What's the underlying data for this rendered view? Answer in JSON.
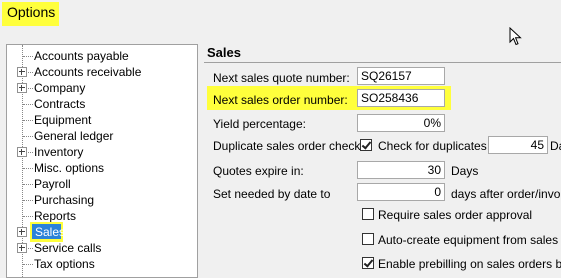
{
  "window": {
    "title": "Options"
  },
  "tree": {
    "items": [
      {
        "label": "Accounts payable",
        "expandable": false
      },
      {
        "label": "Accounts receivable",
        "expandable": true
      },
      {
        "label": "Company",
        "expandable": true
      },
      {
        "label": "Contracts",
        "expandable": false
      },
      {
        "label": "Equipment",
        "expandable": false
      },
      {
        "label": "General ledger",
        "expandable": false
      },
      {
        "label": "Inventory",
        "expandable": true
      },
      {
        "label": "Misc. options",
        "expandable": false
      },
      {
        "label": "Payroll",
        "expandable": false
      },
      {
        "label": "Purchasing",
        "expandable": false
      },
      {
        "label": "Reports",
        "expandable": false
      },
      {
        "label": "Sales",
        "expandable": true,
        "selected": true
      },
      {
        "label": "Service calls",
        "expandable": true
      },
      {
        "label": "Tax options",
        "expandable": false
      }
    ]
  },
  "sales": {
    "header": "Sales",
    "quote_label": "Next sales quote number:",
    "quote_value": "SQ26157",
    "order_label": "Next sales order number:",
    "order_value": "SO258436",
    "yield_label": "Yield percentage:",
    "yield_value": "0%",
    "dup_label": "Duplicate sales order check:",
    "dup_check_label": "Check for duplicates",
    "dup_check_checked": true,
    "dup_days_value": "45",
    "dup_days_suffix": "Da",
    "quotes_label": "Quotes expire in:",
    "quotes_value": "30",
    "quotes_suffix": "Days",
    "needed_label": "Set needed by date to",
    "needed_value": "0",
    "needed_suffix": "days after order/invoic",
    "require_label": "Require sales order approval",
    "require_checked": false,
    "autocreate_label": "Auto-create equipment from sales in",
    "autocreate_checked": false,
    "prebill_label": "Enable prebilling on sales orders by c",
    "prebill_checked": true
  },
  "colors": {
    "highlight": "#ffff3c",
    "selection": "#2b83d9"
  }
}
